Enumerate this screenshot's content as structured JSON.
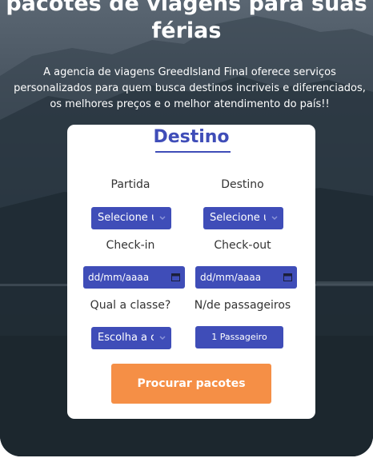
{
  "hero": {
    "title_line1": "pacotes de viagens para suas",
    "title_line2": "férias",
    "description": "A agencia de viagens GreedIsland Final oferece serviços personalizados para quem busca destinos incriveis e diferenciados, os melhores preços e o melhor atendimento do país!!"
  },
  "form": {
    "title": "Destino",
    "departure_label": "Partida",
    "destination_label": "Destino",
    "departure_select": "Selecione uma opção",
    "destination_select": "Selecione uma opção",
    "checkin_label": "Check-in",
    "checkout_label": "Check-out",
    "checkin_value": "dd/mm/aaaa",
    "checkout_value": "dd/mm/aaaa",
    "class_label": "Qual a classe?",
    "passengers_label": "N/de passageiros",
    "class_select": "Escolha a classe",
    "passengers_button": "1 Passageiro",
    "submit_button": "Procurar pacotes"
  },
  "colors": {
    "accent": "#3f4db8",
    "button": "#f58f46"
  },
  "icons": [
    "chevron-down-icon",
    "calendar-icon"
  ]
}
